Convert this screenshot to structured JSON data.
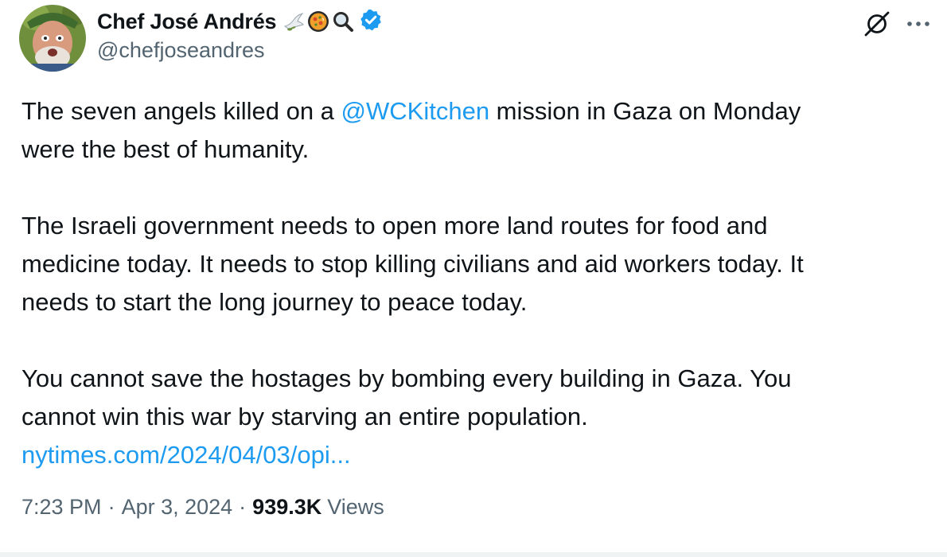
{
  "author": {
    "display_name": "Chef José Andrés",
    "handle": "@chefjoseandres",
    "name_emojis": [
      "dove-emoji",
      "paella-emoji",
      "magnifying-glass-emoji"
    ],
    "verified_badge_color": "#1d9bf0"
  },
  "actions": {
    "grok_icon": "grok-icon",
    "more_icon": "more-icon"
  },
  "tweet": {
    "p1_before": "The seven angels killed on a ",
    "p1_mention": "@WCKitchen",
    "p1_middle": " mission in Gaza on Monday",
    "p1_end": "were the best of humanity.",
    "p2_line1": "The Israeli government needs to open more land routes for food and",
    "p2_line2": "medicine today. It needs to stop killing civilians and aid workers today. It",
    "p2_line3": "needs to start the long journey to peace today.",
    "p3_line1": "You cannot save the hostages by bombing every building in Gaza. You",
    "p3_line2": "cannot win this war by starving an entire population.",
    "link": "nytimes.com/2024/04/03/opi..."
  },
  "meta": {
    "time": "7:23 PM",
    "separator": "·",
    "date": "Apr 3, 2024",
    "views_count": "939.3K",
    "views_label": "Views"
  },
  "colors": {
    "text": "#0f1419",
    "secondary": "#536471",
    "link": "#1d9bf0"
  }
}
